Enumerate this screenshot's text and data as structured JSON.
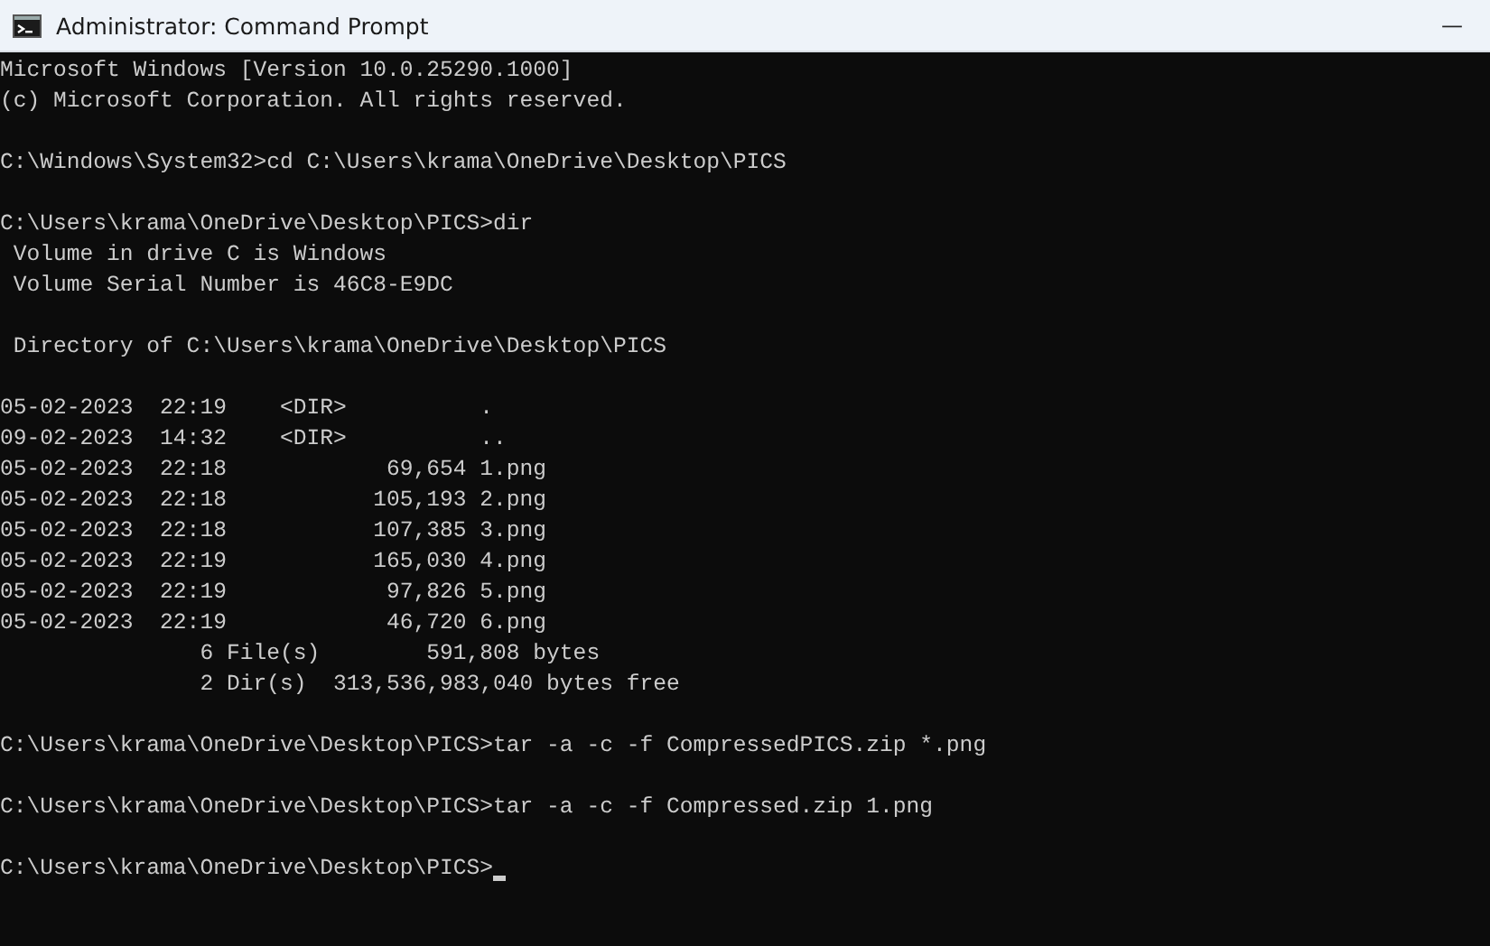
{
  "window": {
    "title": "Administrator: Command Prompt",
    "controls": [
      "—"
    ]
  },
  "terminal": {
    "blocks": [
      [
        "Microsoft Windows [Version 10.0.25290.1000]",
        "(c) Microsoft Corporation. All rights reserved."
      ],
      [
        "C:\\Windows\\System32>cd C:\\Users\\krama\\OneDrive\\Desktop\\PICS"
      ],
      [
        "C:\\Users\\krama\\OneDrive\\Desktop\\PICS>dir",
        " Volume in drive C is Windows",
        " Volume Serial Number is 46C8-E9DC"
      ],
      [
        " Directory of C:\\Users\\krama\\OneDrive\\Desktop\\PICS"
      ],
      [
        "05-02-2023  22:19    <DIR>          .",
        "09-02-2023  14:32    <DIR>          ..",
        "05-02-2023  22:18            69,654 1.png",
        "05-02-2023  22:18           105,193 2.png",
        "05-02-2023  22:18           107,385 3.png",
        "05-02-2023  22:19           165,030 4.png",
        "05-02-2023  22:19            97,826 5.png",
        "05-02-2023  22:19            46,720 6.png",
        "               6 File(s)        591,808 bytes",
        "               2 Dir(s)  313,536,983,040 bytes free"
      ],
      [
        "C:\\Users\\krama\\OneDrive\\Desktop\\PICS>tar -a -c -f CompressedPICS.zip *.png"
      ],
      [
        "C:\\Users\\krama\\OneDrive\\Desktop\\PICS>tar -a -c -f Compressed.zip 1.png"
      ],
      [
        "C:\\Users\\krama\\OneDrive\\Desktop\\PICS>"
      ]
    ],
    "cursor_visible": true
  }
}
